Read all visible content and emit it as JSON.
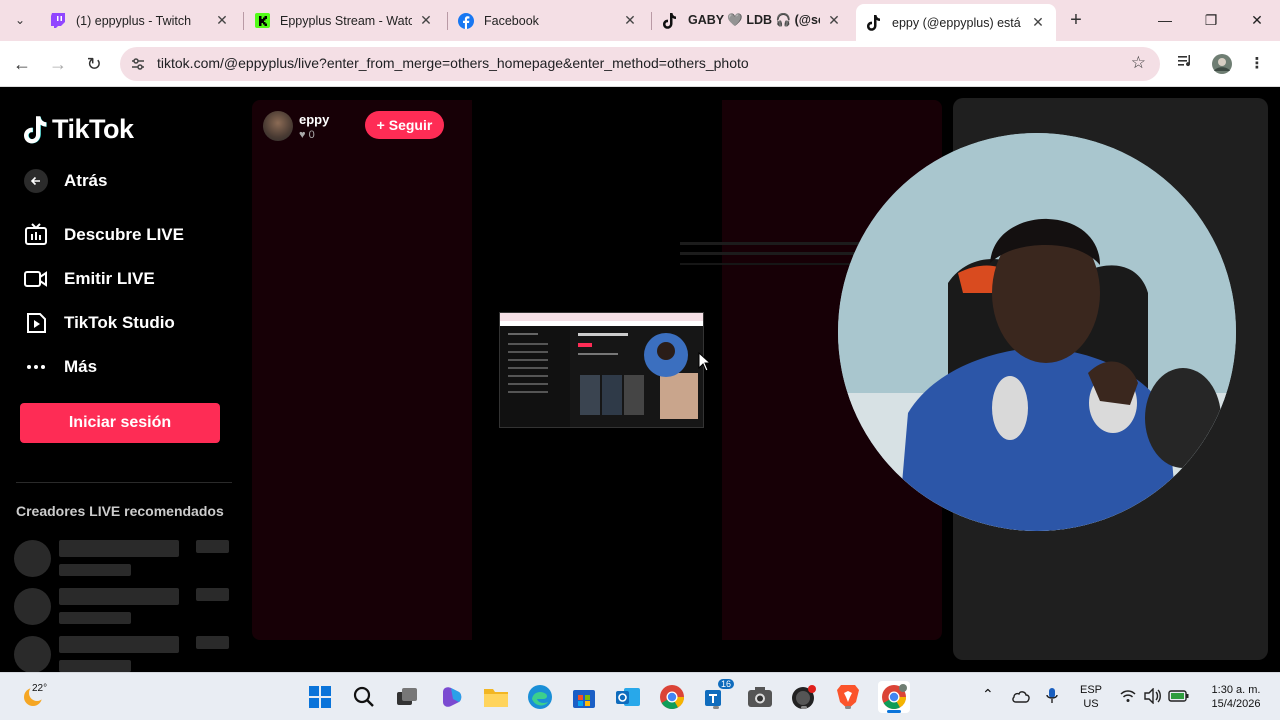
{
  "browser": {
    "tabs": [
      {
        "label": "(1) eppyplus - Twitch",
        "icon": "twitch-icon",
        "active": false
      },
      {
        "label": "Eppyplus Stream - Watch",
        "icon": "kick-icon",
        "active": false
      },
      {
        "label": "Facebook",
        "icon": "facebook-icon",
        "active": false
      },
      {
        "label": "GABY 🩶 LDB 🎧 (@soyg",
        "icon": "tiktok-icon",
        "active": false
      },
      {
        "label": "eppy (@eppyplus) está e",
        "icon": "tiktok-icon",
        "active": true
      }
    ],
    "url": "tiktok.com/@eppyplus/live?enter_from_merge=others_homepage&enter_method=others_photo"
  },
  "sidebar": {
    "logo": "TikTok",
    "back_label": "Atrás",
    "nav": [
      {
        "label": "Descubre LIVE",
        "icon": "live-tv-icon"
      },
      {
        "label": "Emitir LIVE",
        "icon": "camera-icon"
      },
      {
        "label": "TikTok Studio",
        "icon": "studio-icon"
      },
      {
        "label": "Más",
        "icon": "more-dots-icon"
      }
    ],
    "login_label": "Iniciar sesión",
    "recommended_title": "Creadores LIVE recomendados"
  },
  "live": {
    "host_name": "eppy",
    "likes": "0",
    "follow_label": "+ Seguir"
  },
  "taskbar": {
    "weather": "22°",
    "lang_top": "ESP",
    "lang_bottom": "US",
    "time": "1:30 a. m.",
    "date": "15/4/2026",
    "teams_badge": "16"
  },
  "colors": {
    "accent": "#fe2c55",
    "panel": "#170006"
  }
}
